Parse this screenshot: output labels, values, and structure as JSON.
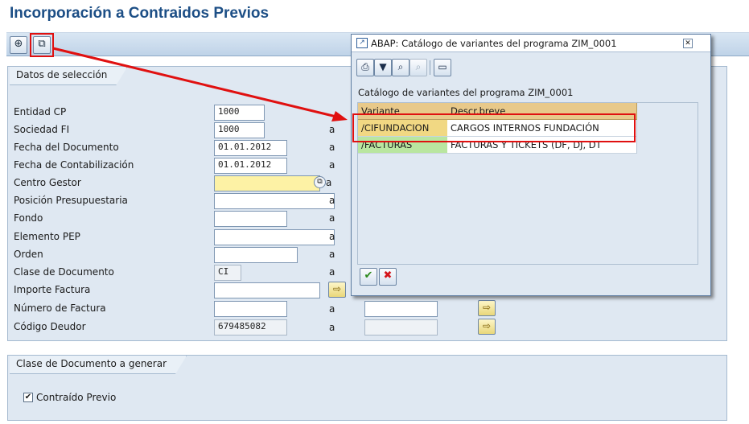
{
  "window_title": "Incorporación a Contraidos Previos",
  "toolbar": {
    "execute_icon": "execute-clock-icon",
    "variants_icon": "get-variant-icon"
  },
  "selection_group": {
    "title": "Datos de selección",
    "range_separator": "a",
    "rows": [
      {
        "label": "Entidad CP",
        "from": "1000",
        "to": ""
      },
      {
        "label": "Sociedad FI",
        "from": "1000",
        "to": ""
      },
      {
        "label": "Fecha del Documento",
        "from": "01.01.2012",
        "to": ""
      },
      {
        "label": "Fecha de Contabilización",
        "from": "01.01.2012",
        "to": ""
      },
      {
        "label": "Centro Gestor",
        "from": "",
        "to": ""
      },
      {
        "label": "Posición Presupuestaria",
        "from": "",
        "to": ""
      },
      {
        "label": "Fondo",
        "from": "",
        "to": ""
      },
      {
        "label": "Elemento PEP",
        "from": "",
        "to": ""
      },
      {
        "label": "Orden",
        "from": "",
        "to": ""
      },
      {
        "label": "Clase de Documento",
        "from": "CI",
        "to": ""
      },
      {
        "label": "Importe Factura",
        "from": "",
        "to": ""
      },
      {
        "label": "Número de Factura",
        "from": "",
        "to": ""
      },
      {
        "label": "Código Deudor",
        "from": "679485082",
        "to": ""
      }
    ]
  },
  "doc_class_group": {
    "title": "Clase de Documento a generar",
    "checkbox_label": "Contraído Previo",
    "checkbox_checked": true
  },
  "popup": {
    "title": "ABAP: Catálogo de variantes del programa ZIM_0001",
    "heading": "Catálogo de variantes del programa ZIM_0001",
    "columns": [
      "Variante",
      "Descr.breve"
    ],
    "rows": [
      {
        "variant": "/CIFUNDACION",
        "description": "CARGOS INTERNOS FUNDACIÓN"
      },
      {
        "variant": "/FACTURAS",
        "description": "FACTURAS Y TICKETS (DF, DJ, DT"
      }
    ],
    "toolbar_icons": [
      "print-icon",
      "filter-icon",
      "find-icon",
      "find-next-icon",
      "print-preview-icon"
    ],
    "ok_icon": "check-icon",
    "cancel_icon": "cancel-icon",
    "close_icon": "close-icon"
  },
  "colors": {
    "title_blue": "#1d4f86",
    "highlight_red": "#e01010",
    "required_field": "#fdf2a5",
    "variant_key_1": "#f1d883",
    "variant_key_2": "#b9e6a0"
  }
}
